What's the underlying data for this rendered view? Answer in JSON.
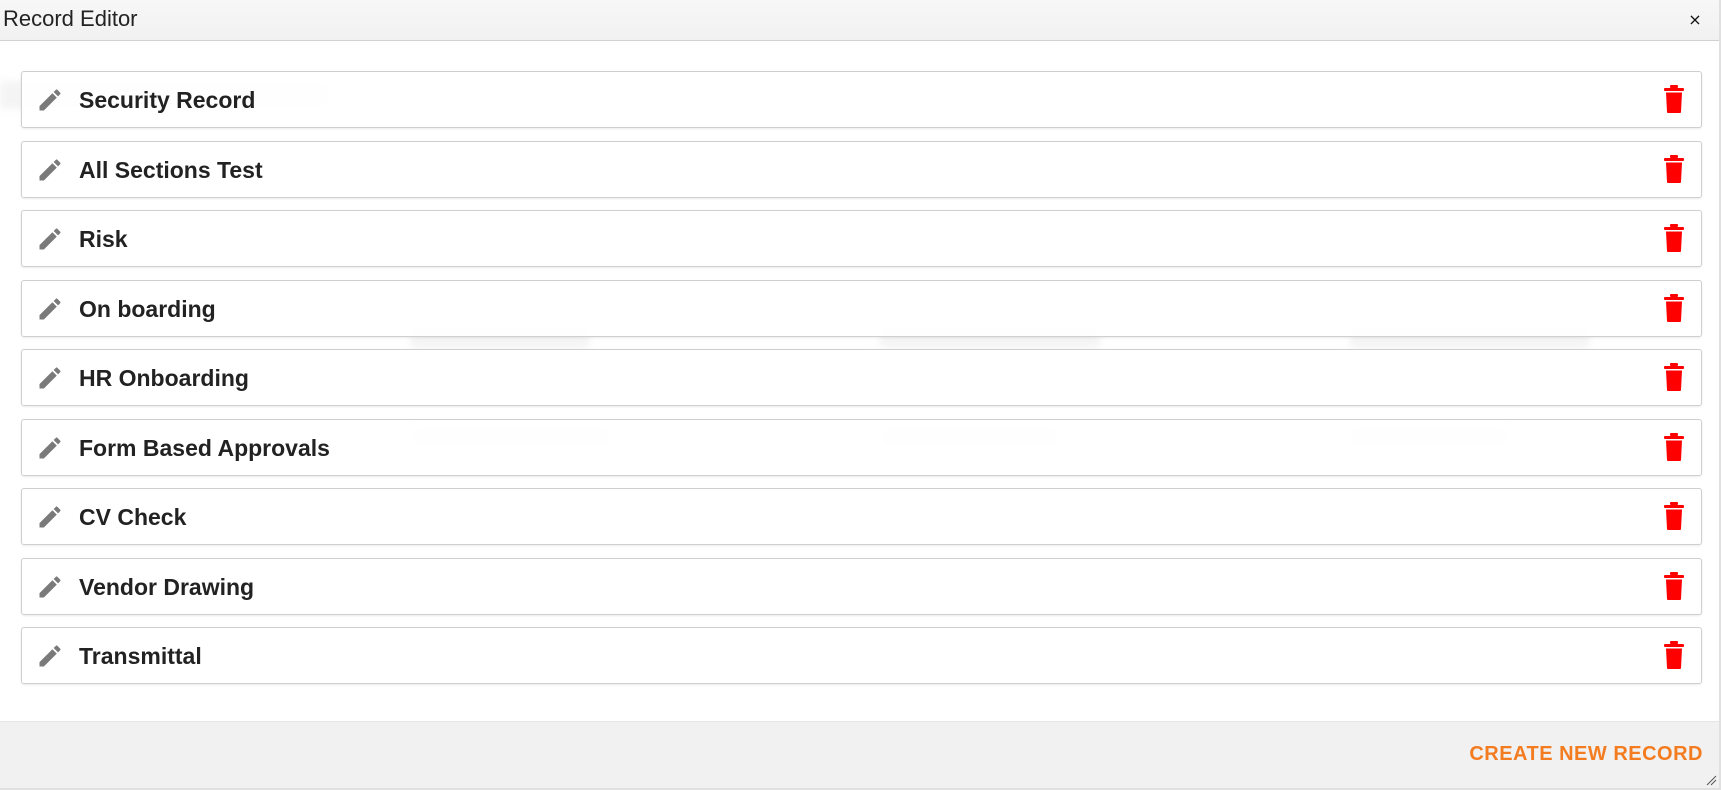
{
  "dialog": {
    "title": "Record Editor",
    "close_label": "×"
  },
  "records": [
    {
      "label": "Security Record"
    },
    {
      "label": "All Sections Test"
    },
    {
      "label": "Risk"
    },
    {
      "label": "On boarding"
    },
    {
      "label": "HR Onboarding"
    },
    {
      "label": "Form Based Approvals"
    },
    {
      "label": "CV Check"
    },
    {
      "label": "Vendor Drawing"
    },
    {
      "label": "Transmittal"
    }
  ],
  "footer": {
    "create_label": "CREATE NEW RECORD"
  },
  "icons": {
    "edit": "pencil-icon",
    "delete": "trash-icon",
    "close": "close-icon",
    "resize": "resize-grip-icon"
  },
  "colors": {
    "accent": "#f47c20",
    "delete": "#ff0000",
    "edit_icon": "#7a7a7a"
  }
}
